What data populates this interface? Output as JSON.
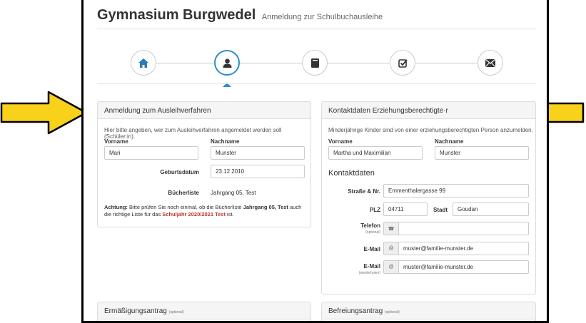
{
  "header": {
    "title": "Gymnasium Burgwedel",
    "subtitle": "Anmeldung zur Schulbuchausleihe"
  },
  "steps": [
    {
      "icon": "home-icon",
      "active": false
    },
    {
      "icon": "user-icon",
      "active": true
    },
    {
      "icon": "book-icon",
      "active": false
    },
    {
      "icon": "check-square-icon",
      "active": false
    },
    {
      "icon": "envelope-icon",
      "active": false
    }
  ],
  "left_panel": {
    "title": "Anmeldung zum Ausleihverfahren",
    "intro": "Hier bitte angeben, wer zum Ausleihverfahren angemeldet werden soll (Schüler:in).",
    "vorname_label": "Vorname",
    "nachname_label": "Nachname",
    "vorname_value": "Mari",
    "nachname_value": "Munster",
    "geburtsdatum_label": "Geburtsdatum",
    "geburtsdatum_value": "23.12.2010",
    "buecherliste_label": "Bücherliste",
    "buecherliste_value": "Jahrgang 05, Test",
    "warning_prefix": "Achtung:",
    "warning_text1": " Bitte prüfen Sie noch einmal, ob die Bücherliste ",
    "warning_bold": "Jahrgang 05, Test",
    "warning_text2": " auch",
    "warning_text3": "die richtige Liste für das ",
    "warning_year": "Schuljahr 2020/2021 Test",
    "warning_text4": " ist."
  },
  "right_panel": {
    "title": "Kontaktdaten Erziehungsberechtigte·r",
    "intro": "Minderjährige Kinder sind von einer erziehungsberechtigten Person anzumelden.",
    "vorname_label": "Vorname",
    "nachname_label": "Nachname",
    "vorname_value": "Martha und Maximilian",
    "nachname_value": "Munster",
    "kontakt_heading": "Kontaktdaten",
    "strasse_label": "Straße & Nr.",
    "strasse_value": "Emmenthalergasse 99",
    "plz_label": "PLZ",
    "plz_value": "04711",
    "stadt_label": "Stadt",
    "stadt_value": "Goudan",
    "telefon_label": "Telefon",
    "telefon_sub": "(optional)",
    "telefon_value": "",
    "email_label": "E-Mail",
    "email_value": "muster@familie-munster.de",
    "email2_label": "E-Mail",
    "email2_sub": "(wiederholen)",
    "email2_value": "muster@familie-munster.de"
  },
  "bottom_left": {
    "title": "Ermäßigungsantrag",
    "sub": "(optional)"
  },
  "bottom_right": {
    "title": "Befreiungsantrag",
    "sub": "(optional)"
  },
  "colors": {
    "accent": "#2b90c9",
    "arrow": "#f7d11a",
    "warning_red": "#c0392b"
  }
}
